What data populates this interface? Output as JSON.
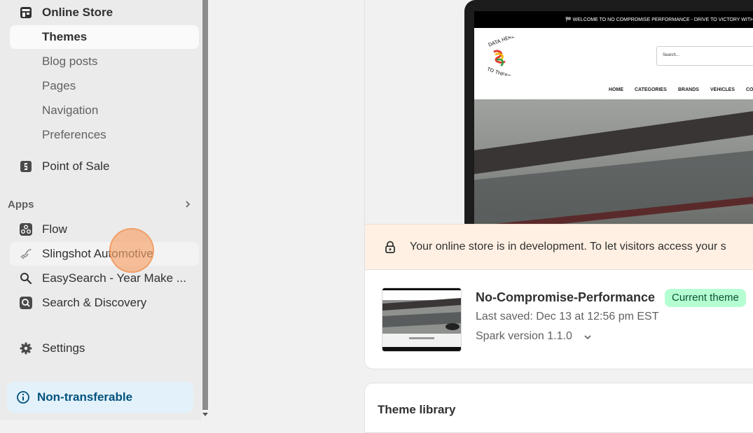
{
  "sidebar": {
    "online_store": "Online Store",
    "themes": "Themes",
    "blog_posts": "Blog posts",
    "pages": "Pages",
    "navigation": "Navigation",
    "preferences": "Preferences",
    "point_of_sale": "Point of Sale",
    "apps_section": "Apps",
    "apps": [
      {
        "label": "Flow",
        "icon": "flow-icon"
      },
      {
        "label": "Slingshot Automotive",
        "icon": "slingshot-icon"
      },
      {
        "label": "EasySearch - Year Make ...",
        "icon": "search-icon"
      },
      {
        "label": "Search & Discovery",
        "icon": "search-discovery-icon"
      }
    ],
    "settings": "Settings",
    "notice": "Non-transferable"
  },
  "preview": {
    "announcement": "🏁 WELCOME TO NO COMPROMISE PERFORMANCE - DRIVE TO VICTORY WITH OU",
    "search_placeholder": "Search...",
    "logo_text": "DATA HERE TO THERE",
    "menu": [
      "HOME",
      "CATEGORIES",
      "BRANDS",
      "VEHICLES",
      "CO"
    ]
  },
  "dev_banner": {
    "text": "Your online store is in development. To let visitors access your s"
  },
  "theme": {
    "name": "No-Compromise-Performance",
    "badge": "Current theme",
    "saved": "Last saved: Dec 13 at 12:56 pm EST",
    "version": "Spark version 1.1.0"
  },
  "library": {
    "title": "Theme library"
  },
  "colors": {
    "sidebar_bg": "#ebebeb",
    "badge_bg": "#b4fed2",
    "banner_bg": "#fff0e3",
    "notice_bg": "#e3f1fb"
  }
}
